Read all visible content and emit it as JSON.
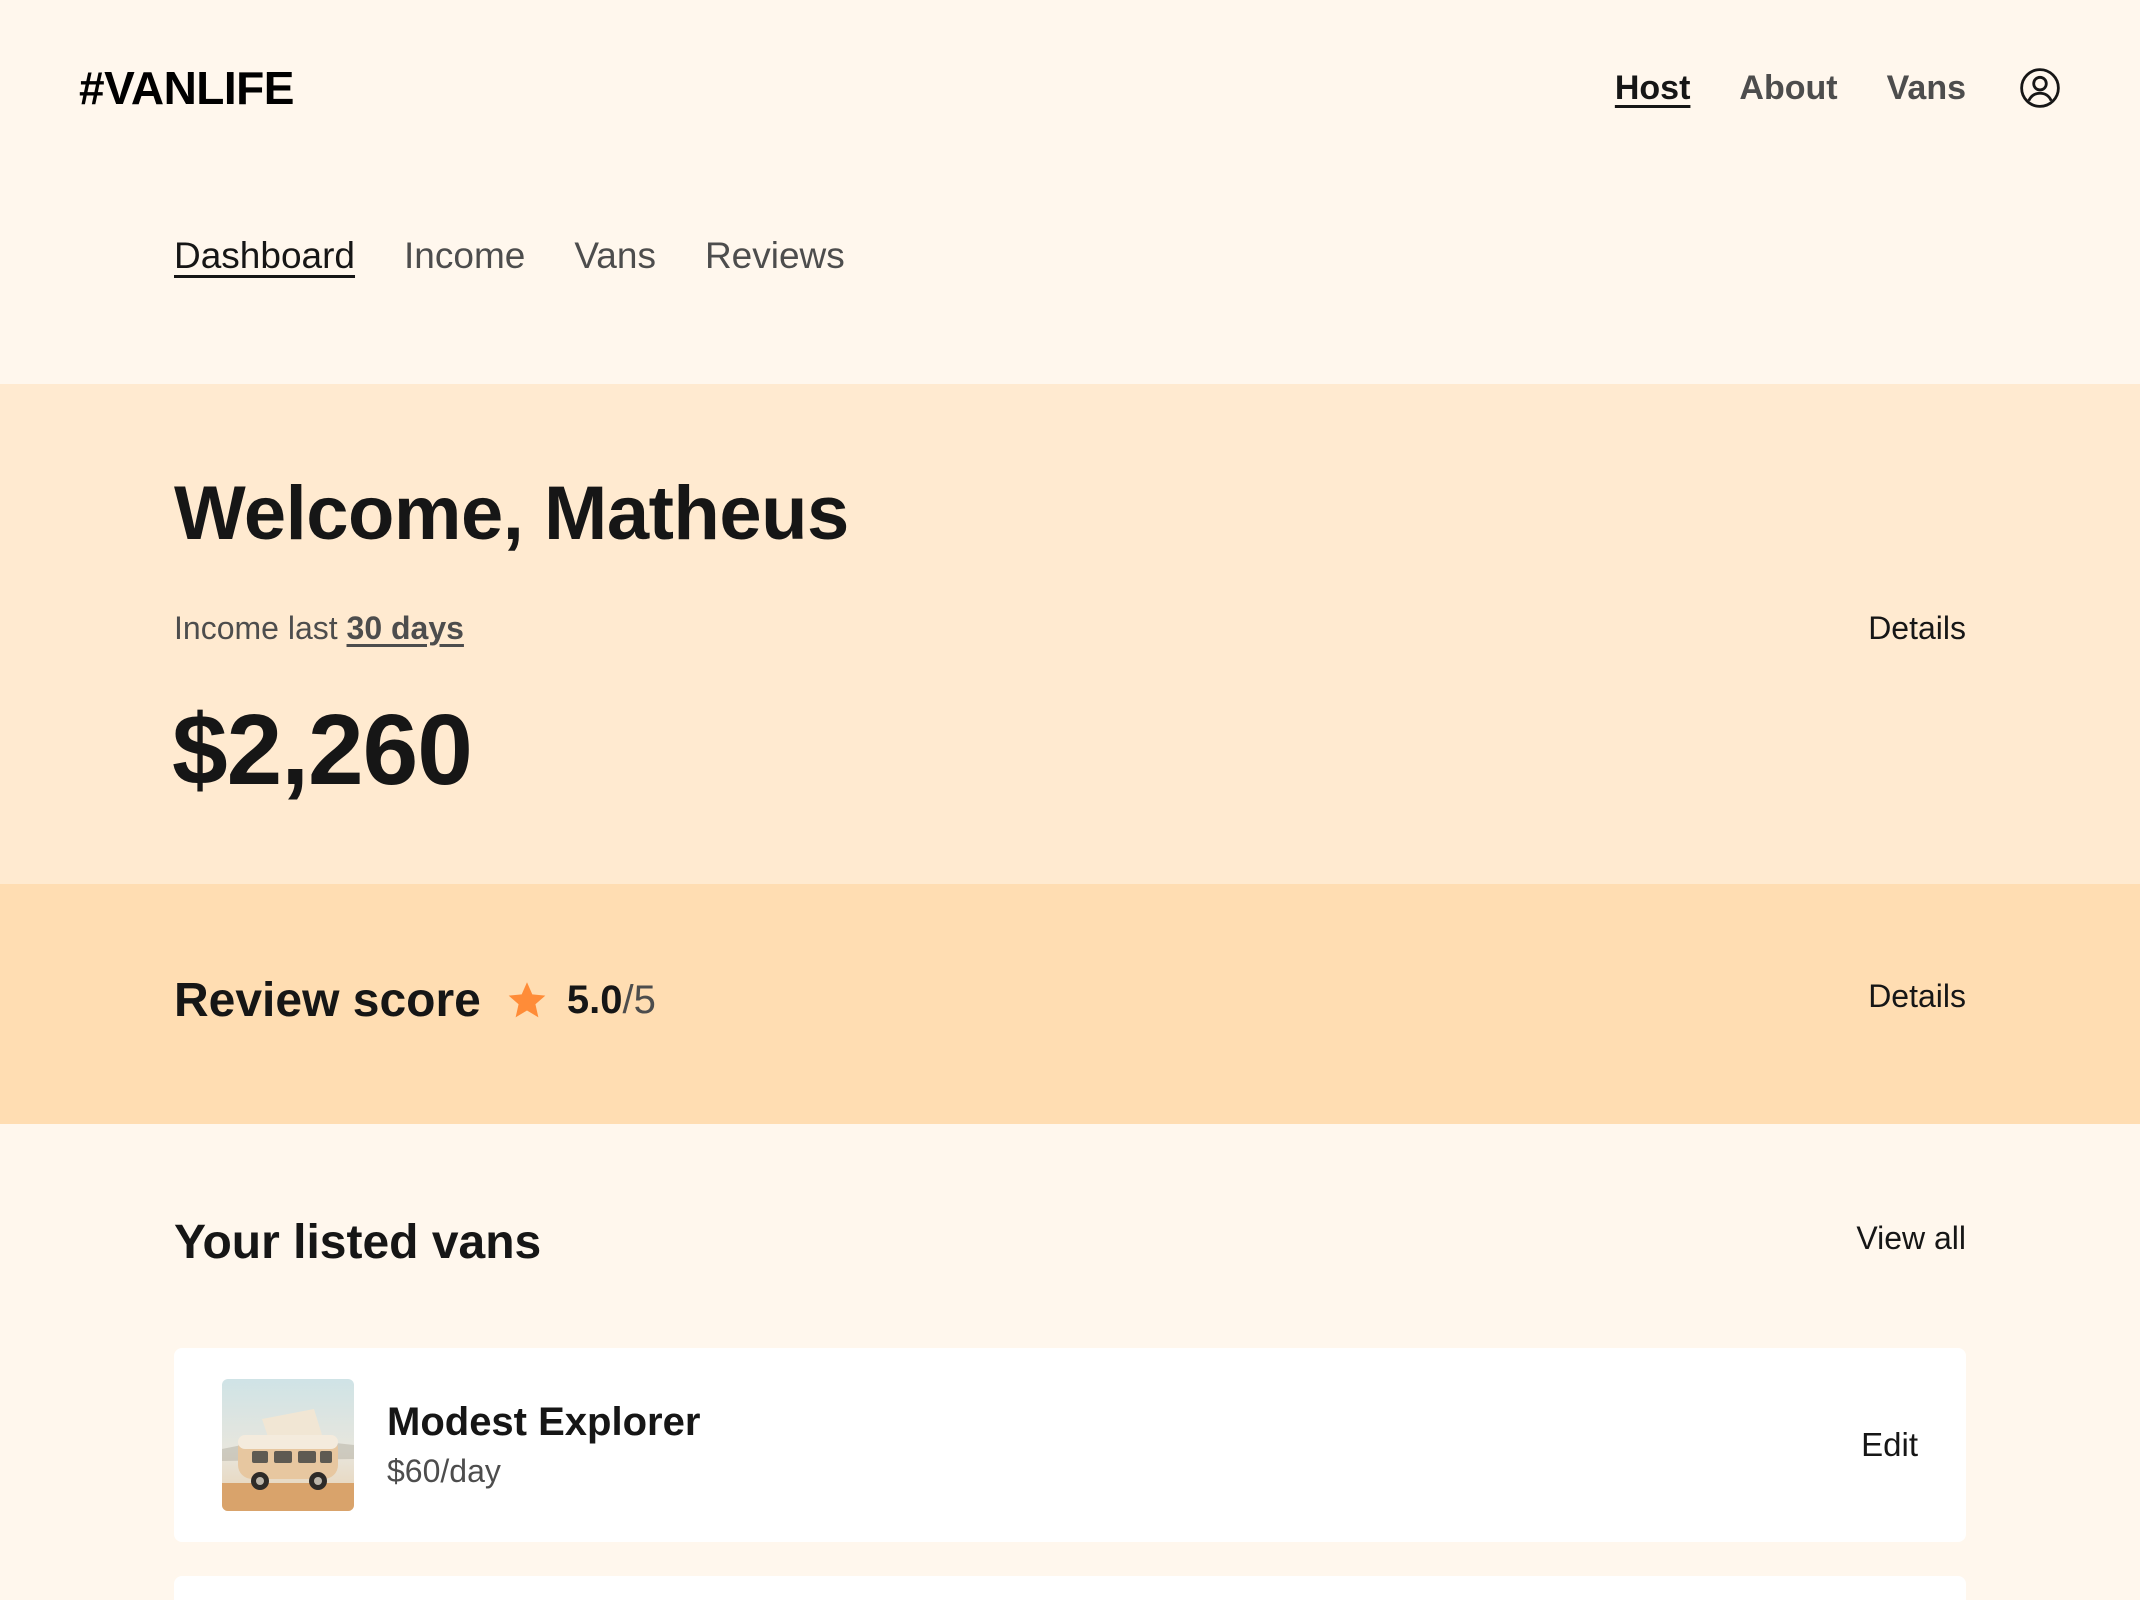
{
  "header": {
    "logo": "#VANLIFE",
    "nav": {
      "host": "Host",
      "about": "About",
      "vans": "Vans"
    },
    "user_icon": "user-circle-icon"
  },
  "host_nav": {
    "dashboard": "Dashboard",
    "income": "Income",
    "vans": "Vans",
    "reviews": "Reviews"
  },
  "income": {
    "welcome": "Welcome, Matheus",
    "label_prefix": "Income last",
    "period": "30 days",
    "value": "$2,260",
    "details": "Details"
  },
  "review": {
    "title": "Review score",
    "star_icon": "star-icon",
    "star_color": "#FF8C38",
    "score": "5.0",
    "max": "/5",
    "details": "Details"
  },
  "listed_vans": {
    "title": "Your listed vans",
    "view_all": "View all",
    "items": [
      {
        "name": "Modest Explorer",
        "price": "$60/day",
        "edit": "Edit"
      }
    ]
  },
  "colors": {
    "page_bg": "#FFF7ED",
    "income_band": "#FFEAD0",
    "review_band": "#FFDDB2",
    "text_dark": "#161616",
    "text_muted": "#4D4D4D"
  }
}
